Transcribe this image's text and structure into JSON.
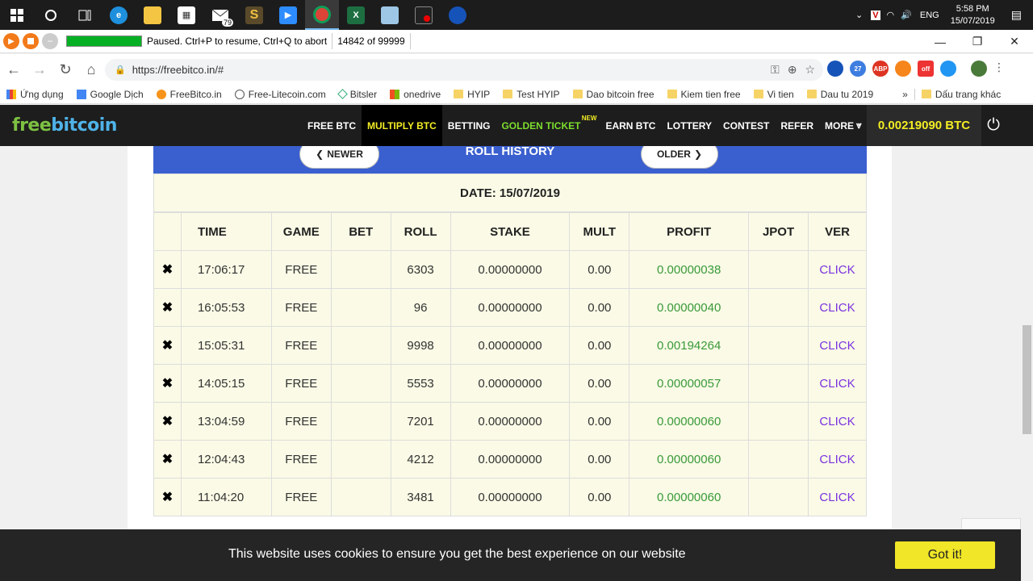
{
  "taskbar": {
    "apps": [
      "start-icon",
      "cortana-icon",
      "task-view-icon",
      "edge-icon",
      "file-explorer-icon",
      "store-icon",
      "mail-icon",
      "s-app-icon",
      "zoom-icon",
      "chrome-icon",
      "excel-icon",
      "notes-icon",
      "recorder-icon",
      "browser-icon"
    ],
    "mail_badge": "79",
    "lang": "ENG",
    "time": "5:58 PM",
    "date": "15/07/2019"
  },
  "extension_bar": {
    "status": "Paused. Ctrl+P to resume, Ctrl+Q to abort",
    "counter": "14842 of 99999"
  },
  "address": {
    "url": "https://freebitco.in/#"
  },
  "bookmarks": [
    {
      "label": "Ứng dụng",
      "icon": "apps-icon"
    },
    {
      "label": "Google Dịch",
      "icon": "translate-icon"
    },
    {
      "label": "FreeBitco.in",
      "icon": "bitcoin-icon"
    },
    {
      "label": "Free-Litecoin.com",
      "icon": "litecoin-icon"
    },
    {
      "label": "Bitsler",
      "icon": "bitsler-icon"
    },
    {
      "label": "onedrive",
      "icon": "windows-icon"
    },
    {
      "label": "HYIP",
      "icon": "folder-icon"
    },
    {
      "label": "Test HYIP",
      "icon": "folder-icon"
    },
    {
      "label": "Dao bitcoin free",
      "icon": "folder-icon"
    },
    {
      "label": "Kiem tien free",
      "icon": "folder-icon"
    },
    {
      "label": "Vi tien",
      "icon": "folder-icon"
    },
    {
      "label": "Dau tu 2019",
      "icon": "folder-icon"
    }
  ],
  "bookmarks_more": "»",
  "bookmarks_other": "Dấu trang khác",
  "site": {
    "logo_a": "free",
    "logo_b": "bitcoin",
    "nav": [
      "FREE BTC",
      "MULTIPLY BTC",
      "BETTING",
      "GOLDEN TICKET",
      "EARN BTC",
      "LOTTERY",
      "CONTEST",
      "REFER",
      "MORE"
    ],
    "new_tag": "NEW",
    "balance": "0.00219090 BTC"
  },
  "roll": {
    "title": "ROLL HISTORY",
    "newer": "NEWER",
    "older": "OLDER",
    "date": "DATE: 15/07/2019",
    "columns": [
      "TIME",
      "GAME",
      "BET",
      "ROLL",
      "STAKE",
      "MULT",
      "PROFIT",
      "JPOT",
      "VER"
    ],
    "rows": [
      {
        "time": "17:06:17",
        "game": "FREE",
        "bet": "",
        "roll": "6303",
        "stake": "0.00000000",
        "mult": "0.00",
        "profit": "0.00000038",
        "jpot": "",
        "ver": "CLICK"
      },
      {
        "time": "16:05:53",
        "game": "FREE",
        "bet": "",
        "roll": "96",
        "stake": "0.00000000",
        "mult": "0.00",
        "profit": "0.00000040",
        "jpot": "",
        "ver": "CLICK"
      },
      {
        "time": "15:05:31",
        "game": "FREE",
        "bet": "",
        "roll": "9998",
        "stake": "0.00000000",
        "mult": "0.00",
        "profit": "0.00194264",
        "jpot": "",
        "ver": "CLICK"
      },
      {
        "time": "14:05:15",
        "game": "FREE",
        "bet": "",
        "roll": "5553",
        "stake": "0.00000000",
        "mult": "0.00",
        "profit": "0.00000057",
        "jpot": "",
        "ver": "CLICK"
      },
      {
        "time": "13:04:59",
        "game": "FREE",
        "bet": "",
        "roll": "7201",
        "stake": "0.00000000",
        "mult": "0.00",
        "profit": "0.00000060",
        "jpot": "",
        "ver": "CLICK"
      },
      {
        "time": "12:04:43",
        "game": "FREE",
        "bet": "",
        "roll": "4212",
        "stake": "0.00000000",
        "mult": "0.00",
        "profit": "0.00000060",
        "jpot": "",
        "ver": "CLICK"
      },
      {
        "time": "11:04:20",
        "game": "FREE",
        "bet": "",
        "roll": "3481",
        "stake": "0.00000000",
        "mult": "0.00",
        "profit": "0.00000060",
        "jpot": "",
        "ver": "CLICK"
      }
    ]
  },
  "cookie": {
    "text": "This website uses cookies to ensure you get the best experience on our website",
    "button": "Got it!"
  },
  "colors": {
    "header_blue": "#3a5fcf",
    "table_bg": "#fafae6",
    "profit_green": "#3a9a3a",
    "ver_purple": "#7b32e0",
    "balance_yellow": "#f3ed24",
    "cookie_button": "#f1e627"
  }
}
